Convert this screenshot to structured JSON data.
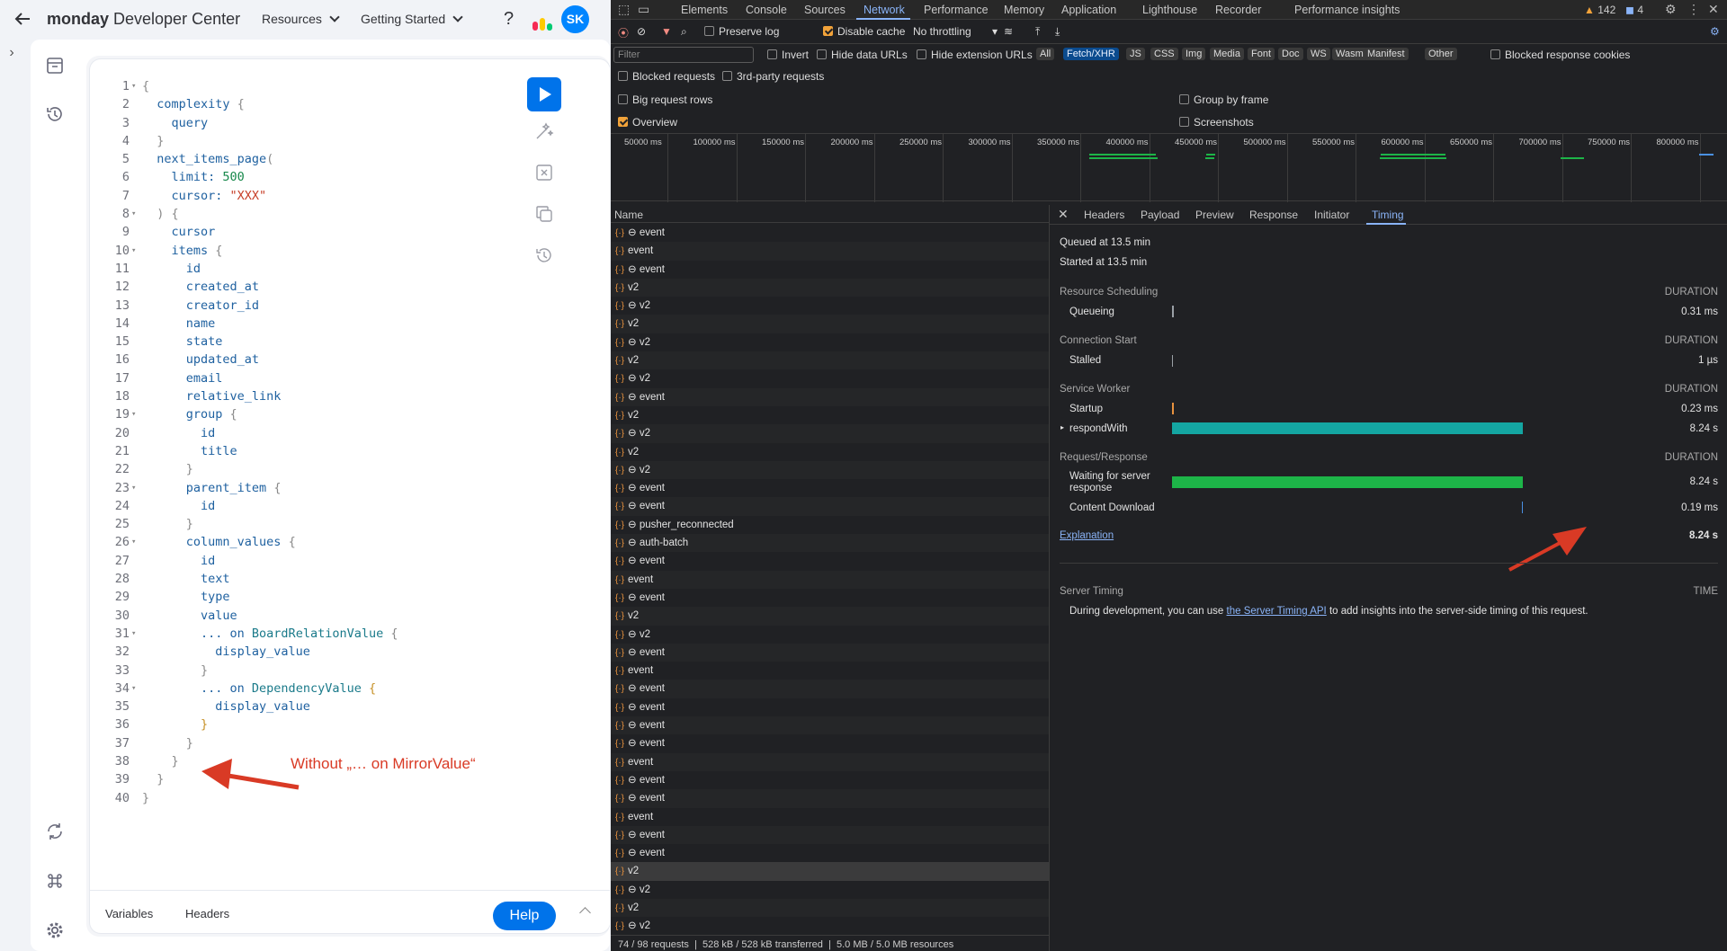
{
  "app": {
    "brand_bold": "monday",
    "brand_rest": " Developer Center",
    "nav": [
      "Resources",
      "Getting Started"
    ],
    "avatar_initials": "SK"
  },
  "editor": {
    "lines": [
      [
        [
          "b",
          "{"
        ]
      ],
      [
        [
          "k",
          "  complexity "
        ],
        [
          "b",
          "{"
        ]
      ],
      [
        [
          "k",
          "    query"
        ]
      ],
      [
        [
          "b",
          "  }"
        ]
      ],
      [
        [
          "k",
          "  next_items_page"
        ],
        [
          "b",
          "("
        ]
      ],
      [
        [
          "k",
          "    limit: "
        ],
        [
          "n",
          "500"
        ]
      ],
      [
        [
          "k",
          "    cursor: "
        ],
        [
          "s",
          "\"XXX\""
        ]
      ],
      [
        [
          "b",
          "  ) {"
        ]
      ],
      [
        [
          "k",
          "    cursor"
        ]
      ],
      [
        [
          "k",
          "    items "
        ],
        [
          "b",
          "{"
        ]
      ],
      [
        [
          "k",
          "      id"
        ]
      ],
      [
        [
          "k",
          "      created_at"
        ]
      ],
      [
        [
          "k",
          "      creator_id"
        ]
      ],
      [
        [
          "k",
          "      name"
        ]
      ],
      [
        [
          "k",
          "      state"
        ]
      ],
      [
        [
          "k",
          "      updated_at"
        ]
      ],
      [
        [
          "k",
          "      email"
        ]
      ],
      [
        [
          "k",
          "      relative_link"
        ]
      ],
      [
        [
          "k",
          "      group "
        ],
        [
          "b",
          "{"
        ]
      ],
      [
        [
          "k",
          "        id"
        ]
      ],
      [
        [
          "k",
          "        title"
        ]
      ],
      [
        [
          "b",
          "      }"
        ]
      ],
      [
        [
          "k",
          "      parent_item "
        ],
        [
          "b",
          "{"
        ]
      ],
      [
        [
          "k",
          "        id"
        ]
      ],
      [
        [
          "b",
          "      }"
        ]
      ],
      [
        [
          "k",
          "      column_values "
        ],
        [
          "b",
          "{"
        ]
      ],
      [
        [
          "k",
          "        id"
        ]
      ],
      [
        [
          "k",
          "        text"
        ]
      ],
      [
        [
          "k",
          "        type"
        ]
      ],
      [
        [
          "k",
          "        value"
        ]
      ],
      [
        [
          "k",
          "        ... on "
        ],
        [
          "t",
          "BoardRelationValue "
        ],
        [
          "b",
          "{"
        ]
      ],
      [
        [
          "k",
          "          display_value"
        ]
      ],
      [
        [
          "b",
          "        }"
        ]
      ],
      [
        [
          "k",
          "        ... on "
        ],
        [
          "t",
          "DependencyValue "
        ],
        [
          "y",
          "{"
        ]
      ],
      [
        [
          "k",
          "          display_value"
        ]
      ],
      [
        [
          "y",
          "        }"
        ]
      ],
      [
        [
          "b",
          "      }"
        ]
      ],
      [
        [
          "b",
          "    }"
        ]
      ],
      [
        [
          "b",
          "  }"
        ]
      ],
      [
        [
          "b",
          "}"
        ]
      ]
    ],
    "folds": [
      1,
      8,
      10,
      19,
      23,
      26,
      31,
      34
    ],
    "footer_tabs": [
      "Variables",
      "Headers"
    ],
    "help_label": "Help",
    "annotation": "Without „… on MirrorValue“"
  },
  "devtools": {
    "tabs": [
      "Elements",
      "Console",
      "Sources",
      "Network",
      "Performance",
      "Memory",
      "Application",
      "Lighthouse",
      "Recorder",
      "Performance insights"
    ],
    "active_tab": "Network",
    "warnings": "142",
    "messages": "4",
    "toolbar": {
      "preserve_log": "Preserve log",
      "disable_cache": "Disable cache",
      "throttling": "No throttling"
    },
    "filter": {
      "placeholder": "Filter",
      "invert": "Invert",
      "hide_data": "Hide data URLs",
      "hide_ext": "Hide extension URLs",
      "chips": [
        "All",
        "Fetch/XHR",
        "JS",
        "CSS",
        "Img",
        "Media",
        "Font",
        "Doc",
        "WS",
        "Wasm",
        "Manifest",
        "Other"
      ],
      "selected_chip": "Fetch/XHR",
      "blocked_cookies": "Blocked response cookies"
    },
    "options": {
      "blocked_requests": "Blocked requests",
      "third_party": "3rd-party requests",
      "big_rows": "Big request rows",
      "group_by_frame": "Group by frame",
      "overview": "Overview",
      "screenshots": "Screenshots"
    },
    "overview_ticks": [
      "50000 ms",
      "100000 ms",
      "150000 ms",
      "200000 ms",
      "250000 ms",
      "300000 ms",
      "350000 ms",
      "400000 ms",
      "450000 ms",
      "500000 ms",
      "550000 ms",
      "600000 ms",
      "650000 ms",
      "700000 ms",
      "750000 ms",
      "800000 ms"
    ],
    "list_header": "Name",
    "requests": [
      "⊖ event",
      "event",
      "⊖ event",
      "v2",
      "⊖ v2",
      "v2",
      "⊖ v2",
      "v2",
      "⊖ v2",
      "⊖ event",
      "v2",
      "⊖ v2",
      "v2",
      "⊖ v2",
      "⊖ event",
      "⊖ event",
      "⊖ pusher_reconnected",
      "⊖ auth-batch",
      "⊖ event",
      "event",
      "⊖ event",
      "v2",
      "⊖ v2",
      "⊖ event",
      "event",
      "⊖ event",
      "⊖ event",
      "⊖ event",
      "⊖ event",
      "event",
      "⊖ event",
      "⊖ event",
      "event",
      "⊖ event",
      "⊖ event",
      "v2",
      "⊖ v2",
      "v2",
      "⊖ v2"
    ],
    "selected_request_index": 35,
    "status": {
      "requests": "74 / 98 requests",
      "transferred": "528 kB / 528 kB transferred",
      "resources": "5.0 MB / 5.0 MB resources"
    },
    "detail_tabs": [
      "Headers",
      "Payload",
      "Preview",
      "Response",
      "Initiator",
      "Timing"
    ],
    "active_detail_tab": "Timing",
    "timing": {
      "queued": "Queued at 13.5 min",
      "started": "Started at 13.5 min",
      "duration_label": "DURATION",
      "sections": [
        {
          "title": "Resource Scheduling",
          "rows": [
            {
              "label": "Queueing",
              "value": "0.31 ms"
            }
          ]
        },
        {
          "title": "Connection Start",
          "rows": [
            {
              "label": "Stalled",
              "value": "1 µs"
            }
          ]
        },
        {
          "title": "Service Worker",
          "rows": [
            {
              "label": "Startup",
              "value": "0.23 ms"
            },
            {
              "label": "respondWith",
              "value": "8.24 s"
            }
          ]
        },
        {
          "title": "Request/Response",
          "rows": [
            {
              "label": "Waiting for server response",
              "value": "8.24 s"
            },
            {
              "label": "Content Download",
              "value": "0.19 ms"
            }
          ]
        }
      ],
      "explanation": "Explanation",
      "total": "8.24 s",
      "server_timing": "Server Timing",
      "time_label": "TIME",
      "server_text_pre": "During development, you can use ",
      "server_link": "the Server Timing API",
      "server_text_post": " to add insights into the server-side timing of this request."
    },
    "colors": {
      "service_worker": "#14a6a2",
      "waiting": "#1db548",
      "accent": "#8ab4f8"
    }
  }
}
